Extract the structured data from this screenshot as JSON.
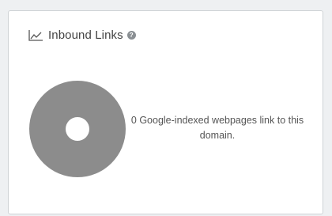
{
  "card": {
    "title": "Inbound Links",
    "title_icon": "line-chart-icon",
    "help_icon": "question-icon",
    "help_glyph": "?",
    "message": "0 Google-indexed webpages link to this domain."
  },
  "chart_data": {
    "type": "pie",
    "categories": [],
    "values": [
      0
    ],
    "title": "",
    "colors": {
      "ring": "#8c8c8c",
      "hole": "#ffffff"
    }
  }
}
